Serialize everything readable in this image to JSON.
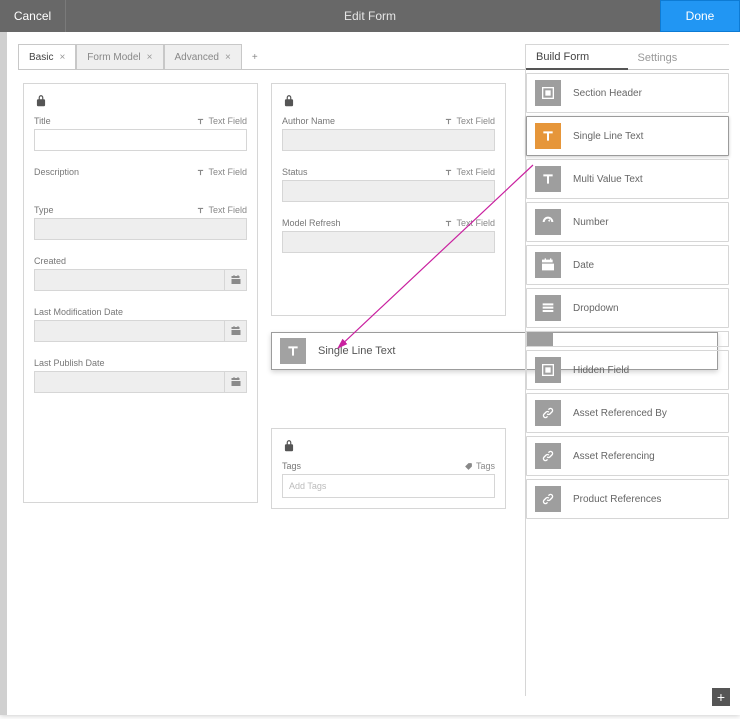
{
  "header": {
    "cancel": "Cancel",
    "title": "Edit Form",
    "done": "Done"
  },
  "tabs": {
    "items": [
      {
        "label": "Basic"
      },
      {
        "label": "Form Model"
      },
      {
        "label": "Advanced"
      }
    ],
    "add_tooltip": "+"
  },
  "canvas": {
    "col1": {
      "fields": [
        {
          "label": "Title",
          "type": "Text Field",
          "kind": "text-white"
        },
        {
          "label": "Description",
          "type": "Text Field",
          "kind": "none"
        },
        {
          "label": "Type",
          "type": "Text Field",
          "kind": "text"
        },
        {
          "label": "Created",
          "type": "",
          "kind": "date"
        },
        {
          "label": "Last Modification Date",
          "type": "",
          "kind": "date"
        },
        {
          "label": "Last Publish Date",
          "type": "",
          "kind": "date"
        }
      ]
    },
    "col2": {
      "fields": [
        {
          "label": "Author Name",
          "type": "Text Field",
          "kind": "text"
        },
        {
          "label": "Status",
          "type": "Text Field",
          "kind": "text"
        },
        {
          "label": "Model Refresh",
          "type": "Text Field",
          "kind": "text"
        }
      ]
    },
    "col3": {
      "tags_label": "Tags",
      "tags_type": "Tags",
      "tags_placeholder": "Add Tags"
    },
    "drop": {
      "label": "Single Line Text"
    }
  },
  "right": {
    "tabs": {
      "build": "Build Form",
      "settings": "Settings"
    },
    "components": [
      {
        "label": "Section Header",
        "icon": "section"
      },
      {
        "label": "Single Line Text",
        "icon": "T",
        "highlight": true
      },
      {
        "label": "Multi Value Text",
        "icon": "T"
      },
      {
        "label": "Number",
        "icon": "gauge"
      },
      {
        "label": "Date",
        "icon": "calendar"
      },
      {
        "label": "Dropdown",
        "icon": "list"
      },
      {
        "label": "Hidden Field",
        "icon": "section"
      },
      {
        "label": "Asset Referenced By",
        "icon": "link"
      },
      {
        "label": "Asset Referencing",
        "icon": "link"
      },
      {
        "label": "Product References",
        "icon": "link"
      }
    ]
  },
  "plus": "+"
}
